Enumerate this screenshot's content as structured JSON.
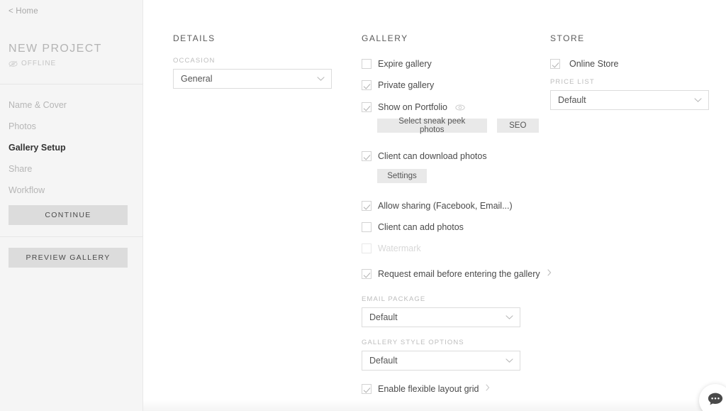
{
  "sidebar": {
    "home_link": "< Home",
    "project_title": "NEW PROJECT",
    "status_label": "OFFLINE",
    "status_icon": "eye-off-icon",
    "nav": [
      {
        "label": "Name & Cover",
        "active": false
      },
      {
        "label": "Photos",
        "active": false
      },
      {
        "label": "Gallery Setup",
        "active": true
      },
      {
        "label": "Share",
        "active": false
      },
      {
        "label": "Workflow",
        "active": false
      }
    ],
    "continue_button": "CONTINUE",
    "preview_button": "PREVIEW GALLERY"
  },
  "details": {
    "heading": "DETAILS",
    "occasion": {
      "label": "OCCASION",
      "value": "General",
      "icon": "chevron-down-icon"
    }
  },
  "gallery": {
    "heading": "GALLERY",
    "checkboxes": {
      "expire_gallery": {
        "label": "Expire gallery",
        "checked": false
      },
      "private_gallery": {
        "label": "Private gallery",
        "checked": true
      },
      "show_on_portfolio": {
        "label": "Show on Portfolio",
        "checked": true,
        "icon": "eye-icon"
      },
      "client_can_download": {
        "label": "Client can download photos",
        "checked": true
      },
      "allow_sharing": {
        "label": "Allow sharing (Facebook, Email...)",
        "checked": true
      },
      "client_can_add": {
        "label": "Client can add photos",
        "checked": false
      },
      "watermark": {
        "label": "Watermark",
        "checked": false,
        "disabled": true
      },
      "request_email": {
        "label": "Request email before entering the gallery",
        "checked": true,
        "icon": "chevron-right-icon"
      },
      "flexible_grid": {
        "label": "Enable flexible layout grid",
        "checked": true,
        "icon": "chevron-right-icon"
      }
    },
    "buttons": {
      "sneak_peek": "Select sneak peek photos",
      "seo": "SEO",
      "settings": "Settings"
    },
    "email_package": {
      "label": "EMAIL PACKAGE",
      "value": "Default",
      "icon": "chevron-down-icon"
    },
    "gallery_style_options": {
      "label": "GALLERY STYLE OPTIONS",
      "value": "Default",
      "icon": "chevron-down-icon"
    }
  },
  "store": {
    "heading": "STORE",
    "online_store": {
      "label": "Online Store",
      "checked": true
    },
    "price_list": {
      "label": "PRICE LIST",
      "value": "Default",
      "icon": "chevron-down-icon"
    }
  },
  "chat": {
    "icon": "chat-bubble-icon"
  },
  "colors": {
    "sidebar_bg": "#f5f5f5",
    "main_bg": "#ffffff",
    "button_bg": "#dcdcdc",
    "pill_bg": "#e9e9e9",
    "text": "#4a4a4a",
    "muted_text": "#b6b6b6",
    "border": "#dcdcdc"
  }
}
